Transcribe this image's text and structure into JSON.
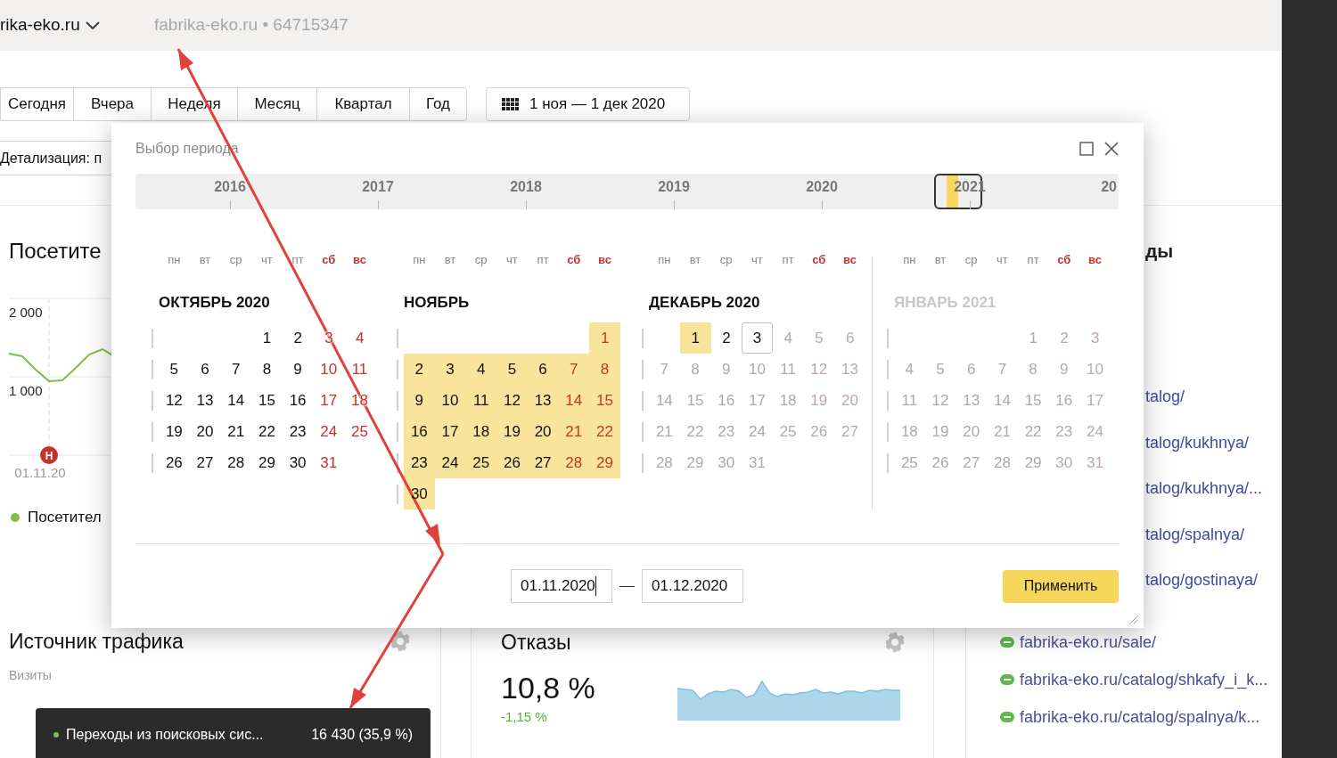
{
  "header": {
    "counter": "rika-eko.ru",
    "site_info": "fabrika-eko.ru • 64715347"
  },
  "periods": [
    "Сегодня",
    "Вчера",
    "Неделя",
    "Месяц",
    "Квартал",
    "Год"
  ],
  "date_range_button": "1 ноя — 1 дек 2020",
  "detail_selector": "Детализация: п",
  "visitors_card": {
    "title": "Посетите",
    "event_marker": "Н",
    "date_label": "01.11.20",
    "legend": "Посетител",
    "axis_labels": [
      "2 000",
      "1 000"
    ]
  },
  "traffic_card": {
    "title": "Источник трафика",
    "subtitle": "Визиты",
    "tooltip": {
      "label": "Переходы из поисковых сис...",
      "value": "16 430 (35,9 %)"
    }
  },
  "bounce_card": {
    "title": "Отказы",
    "value": "10,8 %",
    "change": "-1,15 %"
  },
  "pages_card": {
    "title": "ды",
    "links": [
      {
        "text": "talog/",
        "kind": "cut"
      },
      {
        "text": "talog/kukhnya/",
        "kind": "cut"
      },
      {
        "text": "talog/kukhnya/...",
        "kind": "cut"
      },
      {
        "text": "talog/spalnya/",
        "kind": "cut"
      },
      {
        "text": "talog/gostinaya/",
        "kind": "cut"
      },
      {
        "text": "fabrika-eko.ru/sale/",
        "kind": "full"
      },
      {
        "text": "fabrika-eko.ru/catalog/shkafy_i_k...",
        "kind": "full"
      },
      {
        "text": "fabrika-eko.ru/catalog/spalnya/k...",
        "kind": "full"
      }
    ]
  },
  "modal": {
    "title": "Выбор периода",
    "timeline": [
      "2016",
      "2017",
      "2018",
      "2019",
      "2020",
      "2021",
      "20"
    ],
    "months": [
      {
        "title": "ОКТЯБРЬ 2020",
        "disabled": false,
        "weekdays": [
          {
            "label": "пн",
            "weekend": false
          },
          {
            "label": "вт",
            "weekend": false
          },
          {
            "label": "ср",
            "weekend": false
          },
          {
            "label": "чт",
            "weekend": false
          },
          {
            "label": "пт",
            "weekend": false
          },
          {
            "label": "сб",
            "weekend": true
          },
          {
            "label": "вс",
            "weekend": true
          }
        ],
        "weeks": [
          {
            "days": [
              {
                "day": "1",
                "weekend": false,
                "selected": false,
                "disabled": false,
                "today": false
              },
              {
                "day": "2",
                "weekend": false,
                "selected": false,
                "disabled": false,
                "today": false
              },
              {
                "day": "3",
                "weekend": true,
                "selected": false,
                "disabled": false,
                "today": false
              },
              {
                "day": "4",
                "weekend": true,
                "selected": false,
                "disabled": false,
                "today": false
              }
            ]
          },
          {
            "days": [
              {
                "day": "5",
                "weekend": false,
                "selected": false,
                "disabled": false,
                "today": false
              },
              {
                "day": "6",
                "weekend": false,
                "selected": false,
                "disabled": false,
                "today": false
              },
              {
                "day": "7",
                "weekend": false,
                "selected": false,
                "disabled": false,
                "today": false
              },
              {
                "day": "8",
                "weekend": false,
                "selected": false,
                "disabled": false,
                "today": false
              },
              {
                "day": "9",
                "weekend": false,
                "selected": false,
                "disabled": false,
                "today": false
              },
              {
                "day": "10",
                "weekend": true,
                "selected": false,
                "disabled": false,
                "today": false
              },
              {
                "day": "11",
                "weekend": true,
                "selected": false,
                "disabled": false,
                "today": false
              }
            ]
          },
          {
            "days": [
              {
                "day": "12",
                "weekend": false,
                "selected": false,
                "disabled": false,
                "today": false
              },
              {
                "day": "13",
                "weekend": false,
                "selected": false,
                "disabled": false,
                "today": false
              },
              {
                "day": "14",
                "weekend": false,
                "selected": false,
                "disabled": false,
                "today": false
              },
              {
                "day": "15",
                "weekend": false,
                "selected": false,
                "disabled": false,
                "today": false
              },
              {
                "day": "16",
                "weekend": false,
                "selected": false,
                "disabled": false,
                "today": false
              },
              {
                "day": "17",
                "weekend": true,
                "selected": false,
                "disabled": false,
                "today": false
              },
              {
                "day": "18",
                "weekend": true,
                "selected": false,
                "disabled": false,
                "today": false
              }
            ]
          },
          {
            "days": [
              {
                "day": "19",
                "weekend": false,
                "selected": false,
                "disabled": false,
                "today": false
              },
              {
                "day": "20",
                "weekend": false,
                "selected": false,
                "disabled": false,
                "today": false
              },
              {
                "day": "21",
                "weekend": false,
                "selected": false,
                "disabled": false,
                "today": false
              },
              {
                "day": "22",
                "weekend": false,
                "selected": false,
                "disabled": false,
                "today": false
              },
              {
                "day": "23",
                "weekend": false,
                "selected": false,
                "disabled": false,
                "today": false
              },
              {
                "day": "24",
                "weekend": true,
                "selected": false,
                "disabled": false,
                "today": false
              },
              {
                "day": "25",
                "weekend": true,
                "selected": false,
                "disabled": false,
                "today": false
              }
            ]
          },
          {
            "days": [
              {
                "day": "26",
                "weekend": false,
                "selected": false,
                "disabled": false,
                "today": false
              },
              {
                "day": "27",
                "weekend": false,
                "selected": false,
                "disabled": false,
                "today": false
              },
              {
                "day": "28",
                "weekend": false,
                "selected": false,
                "disabled": false,
                "today": false
              },
              {
                "day": "29",
                "weekend": false,
                "selected": false,
                "disabled": false,
                "today": false
              },
              {
                "day": "30",
                "weekend": false,
                "selected": false,
                "disabled": false,
                "today": false
              },
              {
                "day": "31",
                "weekend": true,
                "selected": false,
                "disabled": false,
                "today": false
              }
            ]
          }
        ]
      },
      {
        "title": "НОЯБРЬ",
        "disabled": false,
        "weekdays": [
          {
            "label": "пн",
            "weekend": false
          },
          {
            "label": "вт",
            "weekend": false
          },
          {
            "label": "ср",
            "weekend": false
          },
          {
            "label": "чт",
            "weekend": false
          },
          {
            "label": "пт",
            "weekend": false
          },
          {
            "label": "сб",
            "weekend": true
          },
          {
            "label": "вс",
            "weekend": true
          }
        ],
        "weeks": [
          {
            "days": [
              {
                "day": "1",
                "weekend": true,
                "selected": true,
                "disabled": false,
                "today": false
              }
            ]
          },
          {
            "days": [
              {
                "day": "2",
                "weekend": false,
                "selected": true,
                "disabled": false,
                "today": false
              },
              {
                "day": "3",
                "weekend": false,
                "selected": true,
                "disabled": false,
                "today": false
              },
              {
                "day": "4",
                "weekend": false,
                "selected": true,
                "disabled": false,
                "today": false
              },
              {
                "day": "5",
                "weekend": false,
                "selected": true,
                "disabled": false,
                "today": false
              },
              {
                "day": "6",
                "weekend": false,
                "selected": true,
                "disabled": false,
                "today": false
              },
              {
                "day": "7",
                "weekend": true,
                "selected": true,
                "disabled": false,
                "today": false
              },
              {
                "day": "8",
                "weekend": true,
                "selected": true,
                "disabled": false,
                "today": false
              }
            ]
          },
          {
            "days": [
              {
                "day": "9",
                "weekend": false,
                "selected": true,
                "disabled": false,
                "today": false
              },
              {
                "day": "10",
                "weekend": false,
                "selected": true,
                "disabled": false,
                "today": false
              },
              {
                "day": "11",
                "weekend": false,
                "selected": true,
                "disabled": false,
                "today": false
              },
              {
                "day": "12",
                "weekend": false,
                "selected": true,
                "disabled": false,
                "today": false
              },
              {
                "day": "13",
                "weekend": false,
                "selected": true,
                "disabled": false,
                "today": false
              },
              {
                "day": "14",
                "weekend": true,
                "selected": true,
                "disabled": false,
                "today": false
              },
              {
                "day": "15",
                "weekend": true,
                "selected": true,
                "disabled": false,
                "today": false
              }
            ]
          },
          {
            "days": [
              {
                "day": "16",
                "weekend": false,
                "selected": true,
                "disabled": false,
                "today": false
              },
              {
                "day": "17",
                "weekend": false,
                "selected": true,
                "disabled": false,
                "today": false
              },
              {
                "day": "18",
                "weekend": false,
                "selected": true,
                "disabled": false,
                "today": false
              },
              {
                "day": "19",
                "weekend": false,
                "selected": true,
                "disabled": false,
                "today": false
              },
              {
                "day": "20",
                "weekend": false,
                "selected": true,
                "disabled": false,
                "today": false
              },
              {
                "day": "21",
                "weekend": true,
                "selected": true,
                "disabled": false,
                "today": false
              },
              {
                "day": "22",
                "weekend": true,
                "selected": true,
                "disabled": false,
                "today": false
              }
            ]
          },
          {
            "days": [
              {
                "day": "23",
                "weekend": false,
                "selected": true,
                "disabled": false,
                "today": false
              },
              {
                "day": "24",
                "weekend": false,
                "selected": true,
                "disabled": false,
                "today": false
              },
              {
                "day": "25",
                "weekend": false,
                "selected": true,
                "disabled": false,
                "today": false
              },
              {
                "day": "26",
                "weekend": false,
                "selected": true,
                "disabled": false,
                "today": false
              },
              {
                "day": "27",
                "weekend": false,
                "selected": true,
                "disabled": false,
                "today": false
              },
              {
                "day": "28",
                "weekend": true,
                "selected": true,
                "disabled": false,
                "today": false
              },
              {
                "day": "29",
                "weekend": true,
                "selected": true,
                "disabled": false,
                "today": false
              }
            ]
          },
          {
            "days": [
              {
                "day": "30",
                "weekend": false,
                "selected": true,
                "disabled": false,
                "today": false
              }
            ]
          }
        ]
      },
      {
        "title": "ДЕКАБРЬ 2020",
        "disabled": false,
        "weekdays": [
          {
            "label": "пн",
            "weekend": false
          },
          {
            "label": "вт",
            "weekend": false
          },
          {
            "label": "ср",
            "weekend": false
          },
          {
            "label": "чт",
            "weekend": false
          },
          {
            "label": "пт",
            "weekend": false
          },
          {
            "label": "сб",
            "weekend": true
          },
          {
            "label": "вс",
            "weekend": true
          }
        ],
        "weeks": [
          {
            "days": [
              {
                "day": "1",
                "weekend": false,
                "selected": true,
                "disabled": false,
                "today": false
              },
              {
                "day": "2",
                "weekend": false,
                "selected": false,
                "disabled": false,
                "today": false
              },
              {
                "day": "3",
                "weekend": false,
                "selected": false,
                "disabled": false,
                "today": true
              },
              {
                "day": "4",
                "weekend": false,
                "selected": false,
                "disabled": true,
                "today": false
              },
              {
                "day": "5",
                "weekend": true,
                "selected": false,
                "disabled": true,
                "today": false
              },
              {
                "day": "6",
                "weekend": true,
                "selected": false,
                "disabled": true,
                "today": false
              }
            ]
          },
          {
            "days": [
              {
                "day": "7",
                "weekend": false,
                "selected": false,
                "disabled": true,
                "today": false
              },
              {
                "day": "8",
                "weekend": false,
                "selected": false,
                "disabled": true,
                "today": false
              },
              {
                "day": "9",
                "weekend": false,
                "selected": false,
                "disabled": true,
                "today": false
              },
              {
                "day": "10",
                "weekend": false,
                "selected": false,
                "disabled": true,
                "today": false
              },
              {
                "day": "11",
                "weekend": false,
                "selected": false,
                "disabled": true,
                "today": false
              },
              {
                "day": "12",
                "weekend": true,
                "selected": false,
                "disabled": true,
                "today": false
              },
              {
                "day": "13",
                "weekend": true,
                "selected": false,
                "disabled": true,
                "today": false
              }
            ]
          },
          {
            "days": [
              {
                "day": "14",
                "weekend": false,
                "selected": false,
                "disabled": true,
                "today": false
              },
              {
                "day": "15",
                "weekend": false,
                "selected": false,
                "disabled": true,
                "today": false
              },
              {
                "day": "16",
                "weekend": false,
                "selected": false,
                "disabled": true,
                "today": false
              },
              {
                "day": "17",
                "weekend": false,
                "selected": false,
                "disabled": true,
                "today": false
              },
              {
                "day": "18",
                "weekend": false,
                "selected": false,
                "disabled": true,
                "today": false
              },
              {
                "day": "19",
                "weekend": true,
                "selected": false,
                "disabled": true,
                "today": false
              },
              {
                "day": "20",
                "weekend": true,
                "selected": false,
                "disabled": true,
                "today": false
              }
            ]
          },
          {
            "days": [
              {
                "day": "21",
                "weekend": false,
                "selected": false,
                "disabled": true,
                "today": false
              },
              {
                "day": "22",
                "weekend": false,
                "selected": false,
                "disabled": true,
                "today": false
              },
              {
                "day": "23",
                "weekend": false,
                "selected": false,
                "disabled": true,
                "today": false
              },
              {
                "day": "24",
                "weekend": false,
                "selected": false,
                "disabled": true,
                "today": false
              },
              {
                "day": "25",
                "weekend": false,
                "selected": false,
                "disabled": true,
                "today": false
              },
              {
                "day": "26",
                "weekend": true,
                "selected": false,
                "disabled": true,
                "today": false
              },
              {
                "day": "27",
                "weekend": true,
                "selected": false,
                "disabled": true,
                "today": false
              }
            ]
          },
          {
            "days": [
              {
                "day": "28",
                "weekend": false,
                "selected": false,
                "disabled": true,
                "today": false
              },
              {
                "day": "29",
                "weekend": false,
                "selected": false,
                "disabled": true,
                "today": false
              },
              {
                "day": "30",
                "weekend": false,
                "selected": false,
                "disabled": true,
                "today": false
              },
              {
                "day": "31",
                "weekend": false,
                "selected": false,
                "disabled": true,
                "today": false
              }
            ]
          }
        ]
      },
      {
        "title": "ЯНВАРЬ 2021",
        "disabled": true,
        "weekdays": [
          {
            "label": "пн",
            "weekend": false
          },
          {
            "label": "вт",
            "weekend": false
          },
          {
            "label": "ср",
            "weekend": false
          },
          {
            "label": "чт",
            "weekend": false
          },
          {
            "label": "пт",
            "weekend": false
          },
          {
            "label": "сб",
            "weekend": true
          },
          {
            "label": "вс",
            "weekend": true
          }
        ],
        "weeks": [
          {
            "days": [
              {
                "day": "1",
                "weekend": false,
                "selected": false,
                "disabled": true,
                "today": false
              },
              {
                "day": "2",
                "weekend": true,
                "selected": false,
                "disabled": true,
                "today": false
              },
              {
                "day": "3",
                "weekend": true,
                "selected": false,
                "disabled": true,
                "today": false
              }
            ]
          },
          {
            "days": [
              {
                "day": "4",
                "weekend": false,
                "selected": false,
                "disabled": true,
                "today": false
              },
              {
                "day": "5",
                "weekend": false,
                "selected": false,
                "disabled": true,
                "today": false
              },
              {
                "day": "6",
                "weekend": false,
                "selected": false,
                "disabled": true,
                "today": false
              },
              {
                "day": "7",
                "weekend": false,
                "selected": false,
                "disabled": true,
                "today": false
              },
              {
                "day": "8",
                "weekend": false,
                "selected": false,
                "disabled": true,
                "today": false
              },
              {
                "day": "9",
                "weekend": true,
                "selected": false,
                "disabled": true,
                "today": false
              },
              {
                "day": "10",
                "weekend": true,
                "selected": false,
                "disabled": true,
                "today": false
              }
            ]
          },
          {
            "days": [
              {
                "day": "11",
                "weekend": false,
                "selected": false,
                "disabled": true,
                "today": false
              },
              {
                "day": "12",
                "weekend": false,
                "selected": false,
                "disabled": true,
                "today": false
              },
              {
                "day": "13",
                "weekend": false,
                "selected": false,
                "disabled": true,
                "today": false
              },
              {
                "day": "14",
                "weekend": false,
                "selected": false,
                "disabled": true,
                "today": false
              },
              {
                "day": "15",
                "weekend": false,
                "selected": false,
                "disabled": true,
                "today": false
              },
              {
                "day": "16",
                "weekend": true,
                "selected": false,
                "disabled": true,
                "today": false
              },
              {
                "day": "17",
                "weekend": true,
                "selected": false,
                "disabled": true,
                "today": false
              }
            ]
          },
          {
            "days": [
              {
                "day": "18",
                "weekend": false,
                "selected": false,
                "disabled": true,
                "today": false
              },
              {
                "day": "19",
                "weekend": false,
                "selected": false,
                "disabled": true,
                "today": false
              },
              {
                "day": "20",
                "weekend": false,
                "selected": false,
                "disabled": true,
                "today": false
              },
              {
                "day": "21",
                "weekend": false,
                "selected": false,
                "disabled": true,
                "today": false
              },
              {
                "day": "22",
                "weekend": false,
                "selected": false,
                "disabled": true,
                "today": false
              },
              {
                "day": "23",
                "weekend": true,
                "selected": false,
                "disabled": true,
                "today": false
              },
              {
                "day": "24",
                "weekend": true,
                "selected": false,
                "disabled": true,
                "today": false
              }
            ]
          },
          {
            "days": [
              {
                "day": "25",
                "weekend": false,
                "selected": false,
                "disabled": true,
                "today": false
              },
              {
                "day": "26",
                "weekend": false,
                "selected": false,
                "disabled": true,
                "today": false
              },
              {
                "day": "27",
                "weekend": false,
                "selected": false,
                "disabled": true,
                "today": false
              },
              {
                "day": "28",
                "weekend": false,
                "selected": false,
                "disabled": true,
                "today": false
              },
              {
                "day": "29",
                "weekend": false,
                "selected": false,
                "disabled": true,
                "today": false
              },
              {
                "day": "30",
                "weekend": true,
                "selected": false,
                "disabled": true,
                "today": false
              },
              {
                "day": "31",
                "weekend": true,
                "selected": false,
                "disabled": true,
                "today": false
              }
            ]
          }
        ]
      }
    ],
    "from": {
      "value": "01.11.2020",
      "focused": true
    },
    "to": {
      "value": "01.12.2020",
      "focused": false
    },
    "apply": "Применить"
  }
}
